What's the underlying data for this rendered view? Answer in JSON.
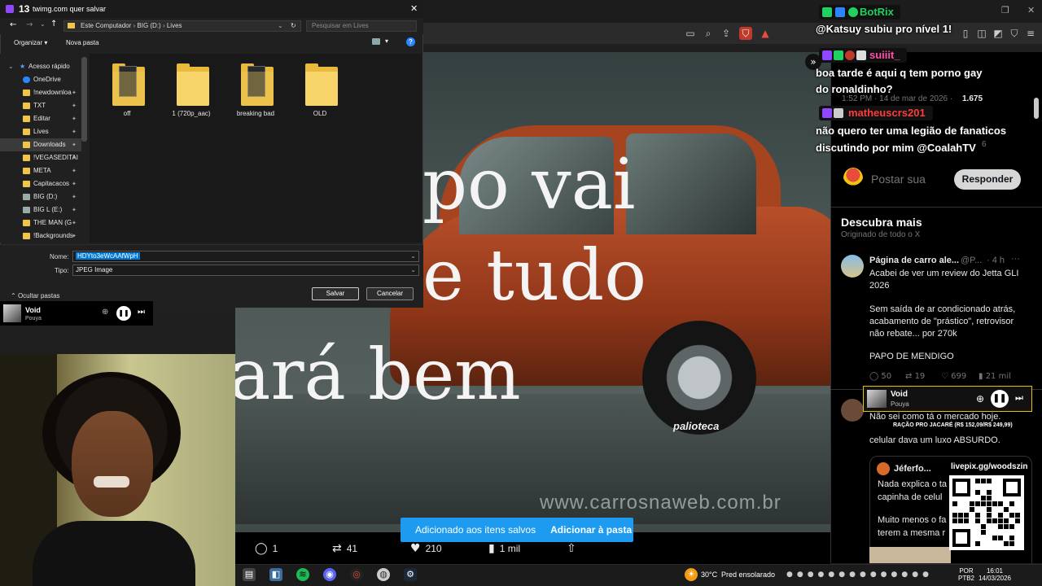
{
  "dialog": {
    "title": "twimg.com quer salvar",
    "title_badge": "13",
    "breadcrumb": [
      "Este Computador",
      "BIG (D:)",
      "Lives"
    ],
    "search_placeholder": "Pesquisar em Lives",
    "organize_label": "Organizar",
    "new_folder_label": "Nova pasta",
    "nav_items": [
      {
        "label": "Acesso rápido",
        "type": "quick"
      },
      {
        "label": "OneDrive",
        "type": "cloud"
      },
      {
        "label": "!newdownloa",
        "type": "folder"
      },
      {
        "label": "TXT",
        "type": "folder"
      },
      {
        "label": "Editar",
        "type": "folder"
      },
      {
        "label": "Lives",
        "type": "folder"
      },
      {
        "label": "Downloads",
        "type": "folder",
        "selected": true
      },
      {
        "label": "!VEGASEDITAI",
        "type": "folder"
      },
      {
        "label": "META",
        "type": "folder"
      },
      {
        "label": "Capitacacos",
        "type": "folder"
      },
      {
        "label": "BIG (D:)",
        "type": "drive"
      },
      {
        "label": "BIG L  (E:)",
        "type": "drive"
      },
      {
        "label": "THE MAN  (G",
        "type": "folder"
      },
      {
        "label": "!Backgrounds",
        "type": "folder"
      }
    ],
    "files": [
      {
        "name": "off",
        "preview": true
      },
      {
        "name": "1 (720p_aac)",
        "preview": false
      },
      {
        "name": "breaking bad",
        "preview": true
      },
      {
        "name": "OLD",
        "preview": false
      }
    ],
    "name_label": "Nome:",
    "name_value": "HDYto3eWcAAfWpH",
    "type_label": "Tipo:",
    "type_value": "JPEG Image",
    "hide_folders_label": "Ocultar pastas",
    "save_label": "Salvar",
    "cancel_label": "Cancelar"
  },
  "mini_player": {
    "title": "Void",
    "artist": "Pouya"
  },
  "video": {
    "text_line1": "po vai",
    "text_line2": "e tudo",
    "text_line3": "cará bem",
    "text_left_fragment": "i",
    "brand": "palioteca",
    "watermark": "www.carrosnaweb.com.br"
  },
  "post_actions": {
    "replies": "1",
    "reposts": "41",
    "likes": "210",
    "views": "1 mil"
  },
  "toast": {
    "message": "Adicionado aos itens salvos",
    "action": "Adicionar à pasta"
  },
  "chat": {
    "botrix_name": "BotRix",
    "botrix_msg": "@Katsuy subiu pro nível 1!",
    "user1_name": "suiiit_",
    "user1_msg": "boa tarde é aqui q tem porno gay do ronaldinho?",
    "user2_name": "matheuscrs201",
    "user2_msg": "não quero ter uma legião de fanaticos discutindo por mim @CoalahTV"
  },
  "feed": {
    "timestamp": "1:52 PM · 14 de mar de 2026 ·",
    "views_count": "1.675",
    "reply_count_hint": "6",
    "reply_placeholder": "Postar sua",
    "reply_button": "Responder",
    "discover_title": "Descubra mais",
    "discover_sub": "Originado de todo o X",
    "post1": {
      "author": "Página de carro ale...",
      "handle": "@P...",
      "time": "· 4 h",
      "text1": "Acabei de ver um review do Jetta GLI 2026",
      "text2": "Sem saída de ar condicionado atrás, acabamento de \"prástico\", retrovisor não rebate... por 270k",
      "text3": "PAPO DE MENDIGO",
      "replies": "50",
      "reposts": "19",
      "likes": "699",
      "views": "21 mil"
    },
    "post2": {
      "text1": "Não sei como tá o mercado hoje.",
      "text2": "celular dava um luxo ABSURDO."
    },
    "quote": {
      "author": "Jéferfo...",
      "text1": "Nada explica o ta",
      "text2": "capinha de celul",
      "text3": "Muito menos o fa",
      "text4": "terem a mesma r"
    }
  },
  "overlay_player": {
    "title": "Void",
    "artist": "Pouya",
    "promo_line": "RAÇÃO PRO JACARÉ (R$ 152,09/R$ 249,99)",
    "livepix": "livepix.gg/woodszin"
  },
  "taskbar": {
    "temperature": "30°C",
    "weather": "Pred ensolarado",
    "lang1": "POR",
    "lang2": "PTB2",
    "time": "16:01",
    "date": "14/03/2026"
  },
  "colors": {
    "accent": "#1d9bf0",
    "chat_user1": "#ff4fa8",
    "chat_user2": "#ff3b3b",
    "botrix": "#20d060",
    "folder": "#f0c64a"
  }
}
